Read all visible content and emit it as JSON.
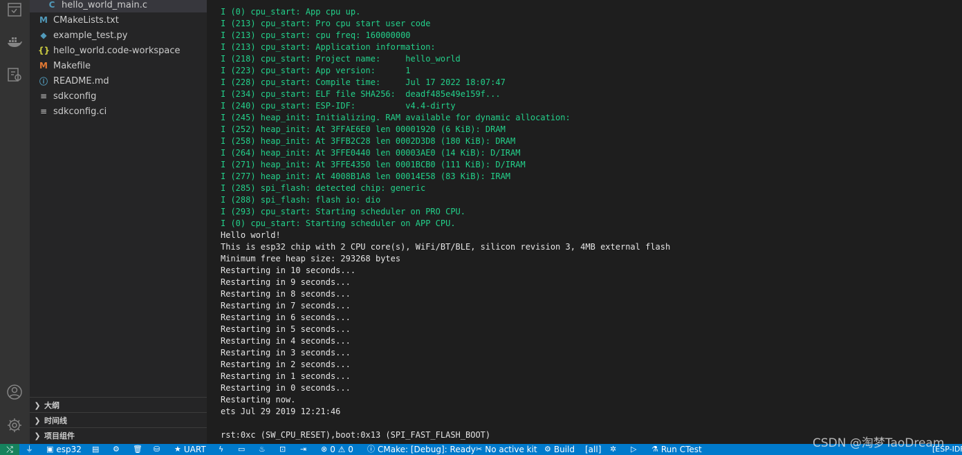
{
  "explorer": {
    "files": [
      {
        "name": "hello_world_main.c",
        "icon": "c-file-icon",
        "glyph": "C"
      },
      {
        "name": "CMakeLists.txt",
        "icon": "cmake-file-icon",
        "glyph": "M"
      },
      {
        "name": "example_test.py",
        "icon": "python-file-icon",
        "glyph": "◆"
      },
      {
        "name": "hello_world.code-workspace",
        "icon": "json-file-icon",
        "glyph": "{}"
      },
      {
        "name": "Makefile",
        "icon": "makefile-icon",
        "glyph": "M"
      },
      {
        "name": "README.md",
        "icon": "info-icon",
        "glyph": "ⓘ"
      },
      {
        "name": "sdkconfig",
        "icon": "config-file-icon",
        "glyph": "≡"
      },
      {
        "name": "sdkconfig.ci",
        "icon": "config-file-icon",
        "glyph": "≡"
      }
    ],
    "sections": [
      "大纲",
      "时间线",
      "项目组件"
    ]
  },
  "terminal": {
    "lines": [
      {
        "text": "I (0) cpu_start: App cpu up.",
        "style": "green"
      },
      {
        "text": "I (213) cpu_start: Pro cpu start user code",
        "style": "green"
      },
      {
        "text": "I (213) cpu_start: cpu freq: 160000000",
        "style": "green"
      },
      {
        "text": "I (213) cpu_start: Application information:",
        "style": "green"
      },
      {
        "text": "I (218) cpu_start: Project name:     hello_world",
        "style": "green"
      },
      {
        "text": "I (223) cpu_start: App version:      1",
        "style": "green"
      },
      {
        "text": "I (228) cpu_start: Compile time:     Jul 17 2022 18:07:47",
        "style": "green"
      },
      {
        "text": "I (234) cpu_start: ELF file SHA256:  deadf485e49e159f...",
        "style": "green"
      },
      {
        "text": "I (240) cpu_start: ESP-IDF:          v4.4-dirty",
        "style": "green"
      },
      {
        "text": "I (245) heap_init: Initializing. RAM available for dynamic allocation:",
        "style": "green"
      },
      {
        "text": "I (252) heap_init: At 3FFAE6E0 len 00001920 (6 KiB): DRAM",
        "style": "green"
      },
      {
        "text": "I (258) heap_init: At 3FFB2C28 len 0002D3D8 (180 KiB): DRAM",
        "style": "green"
      },
      {
        "text": "I (264) heap_init: At 3FFE0440 len 00003AE0 (14 KiB): D/IRAM",
        "style": "green"
      },
      {
        "text": "I (271) heap_init: At 3FFE4350 len 0001BCB0 (111 KiB): D/IRAM",
        "style": "green"
      },
      {
        "text": "I (277) heap_init: At 4008B1A8 len 00014E58 (83 KiB): IRAM",
        "style": "green"
      },
      {
        "text": "I (285) spi_flash: detected chip: generic",
        "style": "green"
      },
      {
        "text": "I (288) spi_flash: flash io: dio",
        "style": "green"
      },
      {
        "text": "I (293) cpu_start: Starting scheduler on PRO CPU.",
        "style": "green"
      },
      {
        "text": "I (0) cpu_start: Starting scheduler on APP CPU.",
        "style": "green"
      },
      {
        "text": "Hello world!",
        "style": "white"
      },
      {
        "text": "This is esp32 chip with 2 CPU core(s), WiFi/BT/BLE, silicon revision 3, 4MB external flash",
        "style": "white"
      },
      {
        "text": "Minimum free heap size: 293268 bytes",
        "style": "white"
      },
      {
        "text": "Restarting in 10 seconds...",
        "style": "white"
      },
      {
        "text": "Restarting in 9 seconds...",
        "style": "white"
      },
      {
        "text": "Restarting in 8 seconds...",
        "style": "white"
      },
      {
        "text": "Restarting in 7 seconds...",
        "style": "white"
      },
      {
        "text": "Restarting in 6 seconds...",
        "style": "white"
      },
      {
        "text": "Restarting in 5 seconds...",
        "style": "white"
      },
      {
        "text": "Restarting in 4 seconds...",
        "style": "white"
      },
      {
        "text": "Restarting in 3 seconds...",
        "style": "white"
      },
      {
        "text": "Restarting in 2 seconds...",
        "style": "white"
      },
      {
        "text": "Restarting in 1 seconds...",
        "style": "white"
      },
      {
        "text": "Restarting in 0 seconds...",
        "style": "white"
      },
      {
        "text": "Restarting now.",
        "style": "white"
      },
      {
        "text": "ets Jul 29 2019 12:21:46",
        "style": "white"
      },
      {
        "text": "",
        "style": "white"
      },
      {
        "text": "rst:0xc (SW_CPU_RESET),boot:0x13 (SPI_FAST_FLASH_BOOT)",
        "style": "white"
      }
    ]
  },
  "statusbar": {
    "items": [
      {
        "id": "plug",
        "glyph": "⏚",
        "label": ""
      },
      {
        "id": "target",
        "glyph": "▣",
        "label": "esp32"
      },
      {
        "id": "folder",
        "glyph": "▤",
        "label": ""
      },
      {
        "id": "settings",
        "glyph": "⚙",
        "label": ""
      },
      {
        "id": "trash",
        "glyph": "🗑",
        "label": ""
      },
      {
        "id": "db",
        "glyph": "⛁",
        "label": ""
      },
      {
        "id": "uart",
        "glyph": "★",
        "label": "UART"
      },
      {
        "id": "flash",
        "glyph": "ϟ",
        "label": ""
      },
      {
        "id": "monitor",
        "glyph": "▭",
        "label": ""
      },
      {
        "id": "fire",
        "glyph": "♨",
        "label": ""
      },
      {
        "id": "terminal",
        "glyph": "⊡",
        "label": ""
      },
      {
        "id": "export",
        "glyph": "⇥",
        "label": ""
      },
      {
        "id": "problems",
        "glyph": "⊗",
        "label": "0 ⚠ 0"
      },
      {
        "id": "cmake",
        "glyph": "ⓘ",
        "label": "CMake: [Debug]: Ready"
      },
      {
        "id": "kit",
        "glyph": "✂",
        "label": "No active kit"
      },
      {
        "id": "build",
        "glyph": "⚙",
        "label": "Build"
      },
      {
        "id": "all",
        "glyph": "",
        "label": "[all]"
      },
      {
        "id": "debug",
        "glyph": "✲",
        "label": ""
      },
      {
        "id": "run",
        "glyph": "▷",
        "label": ""
      },
      {
        "id": "ctest",
        "glyph": "⚗",
        "label": "Run CTest"
      }
    ],
    "right_label": "[ESP-IDF",
    "remote_glyph": "⤭"
  },
  "watermark": "CSDN @淘梦TaoDream"
}
